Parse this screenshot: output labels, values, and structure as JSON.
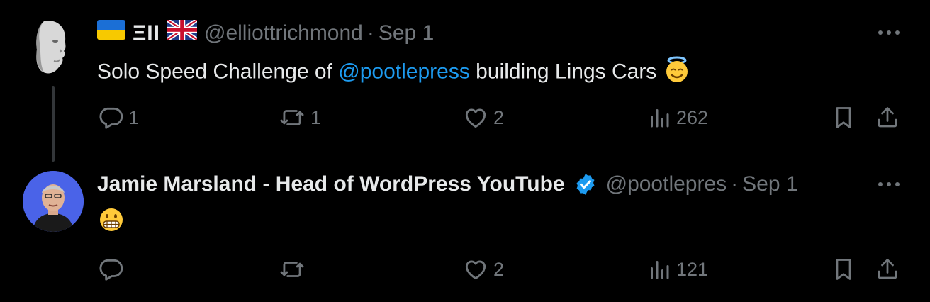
{
  "colors": {
    "background": "#000000",
    "text": "#e7e9ea",
    "muted": "#71767b",
    "link": "#1d9bf0",
    "verified": "#1d9bf0"
  },
  "tweets": [
    {
      "display_name_logo": "ΞII",
      "flags": [
        "ukraine-flag",
        "uk-flag"
      ],
      "handle": "@elliottrichmond",
      "separator": "·",
      "date": "Sep 1",
      "text_before": "Solo Speed Challenge of ",
      "mention": "@pootlepress",
      "text_after": " building Lings Cars ",
      "emoji": "smiling-face-with-halo",
      "replies": "1",
      "reposts": "1",
      "likes": "2",
      "views": "262"
    },
    {
      "display_name": "Jamie Marsland - Head of WordPress YouTube",
      "verified": true,
      "handle": "@pootlepres",
      "separator": "·",
      "date": "Sep 1",
      "emoji": "grimacing-face",
      "replies": "",
      "reposts": "",
      "likes": "2",
      "views": "121"
    }
  ]
}
